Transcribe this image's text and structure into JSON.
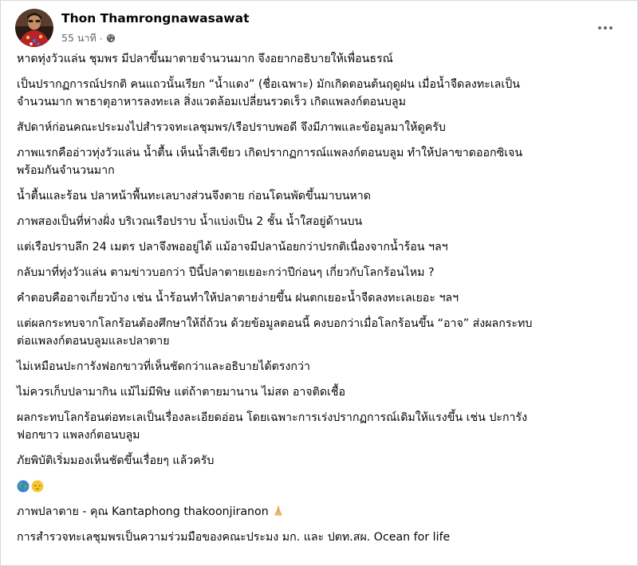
{
  "post": {
    "author": "Thon Thamrongnawasawat",
    "time": "55 นาที",
    "separator": "·",
    "privacy_icon": "globe-icon",
    "more_icon": "more-options-icon"
  },
  "paragraphs": [
    "หาดทุ่งวัวแล่น ชุมพร มีปลาขึ้นมาตายจำนวนมาก จึงอยากอธิบายให้เพื่อนธรณ์",
    "เป็นปรากฏการณ์ปรกติ คนแถวนั้นเรียก “น้ำแดง” (ชื่อเฉพาะ) มักเกิดตอนต้นฤดูฝน เมื่อน้ำจืดลงทะเลเป็น",
    "จำนวนมาก พาธาตุอาหารลงทะเล สิ่งแวดล้อมเปลี่ยนรวดเร็ว เกิดแพลงก์ตอนบลูม",
    "สัปดาห์ก่อนคณะประมงไปสำรวจทะเลชุมพร/เรือปราบพอดี จึงมีภาพและข้อมูลมาให้ดูครับ",
    "ภาพแรกคืออ่าวทุ่งวัวแล่น น้ำตื้น เห็นน้ำสีเขียว เกิดปรากฏการณ์แพลงก์ตอนบลูม ทำให้ปลาขาดออกซิเจน",
    "พร้อมกันจำนวนมาก",
    "น้ำตื้นและร้อน ปลาหน้าพื้นทะเลบางส่วนจึงตาย ก่อนโดนพัดขึ้นมาบนหาด",
    "ภาพสองเป็นที่ห่างฝั่ง บริเวณเรือปราบ  น้ำแบ่งเป็น 2 ชั้น น้ำใสอยู่ด้านบน",
    "แต่เรือปราบลึก 24 เมตร ปลาจึงพออยู่ได้ แม้อาจมีปลาน้อยกว่าปรกติเนื่องจากน้ำร้อน ฯลฯ",
    "กลับมาที่ทุ่งวัวแล่น ตามข่าวบอกว่า ปีนี้ปลาตายเยอะกว่าปีก่อนๆ เกี่ยวกับโลกร้อนไหม ?",
    "คำตอบคืออาจเกี่ยวบ้าง เช่น น้ำร้อนทำให้ปลาตายง่ายขึ้น ฝนตกเยอะน้ำจืดลงทะเลเยอะ ฯลฯ",
    "แต่ผลกระทบจากโลกร้อนต้องศึกษาให้ถี่ถ้วน ด้วยข้อมูลตอนนี้ คงบอกว่าเมื่อโลกร้อนขึ้น “อาจ” ส่งผลกระทบ",
    "ต่อแพลงก์ตอนบลูมและปลาตาย",
    "ไม่เหมือนปะการังฟอกขาวที่เห็นชัดกว่าและอธิบายได้ตรงกว่า",
    "ไม่ควรเก็บปลามากิน แม้ไม่มีพิษ แต่ถ้าตายมานาน ไม่สด อาจติดเชื้อ",
    "ผลกระทบโลกร้อนต่อทะเลเป็นเรื่องละเอียดอ่อน โดยเฉพาะการเร่งปรากฏการณ์เดิมให้แรงขึ้น เช่น ปะการัง",
    "ฟอกขาว แพลงก์ตอนบลูม",
    "ภัยพิบัติเริ่มมองเห็นชัดขึ้นเรื่อยๆ แล้วครับ"
  ],
  "emojis": [
    "globe-earth-emoji",
    "pensive-face-emoji"
  ],
  "credit": "ภาพปลาตาย - คุณ Kantaphong thakoonjiranon",
  "credit_emoji": "folded-hands-emoji",
  "footer_note": "การสำรวจทะเลชุมพรเป็นความร่วมมือของคณะประมง มก. และ ปตท.สผ. Ocean for life",
  "colors": {
    "text": "#050505",
    "secondary": "#65676b",
    "border": "#d6d8dc"
  }
}
